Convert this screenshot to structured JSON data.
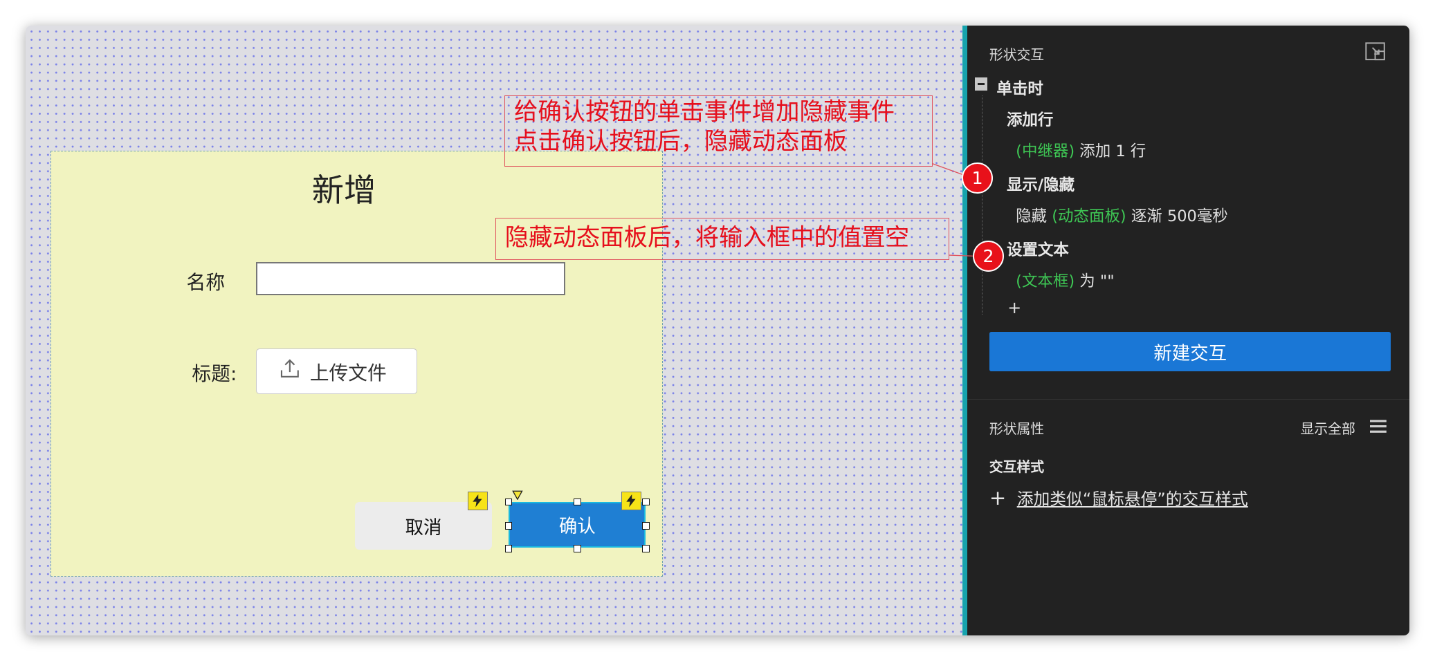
{
  "dialog": {
    "title": "新增",
    "name_label": "名称",
    "name_value": "",
    "title_label": "标题:",
    "upload_label": "上传文件",
    "cancel_label": "取消",
    "confirm_label": "确认"
  },
  "annotations": [
    {
      "number": "1",
      "lines": [
        "给确认按钮的单击事件增加隐藏事件",
        "点击确认按钮后，隐藏动态面板"
      ]
    },
    {
      "number": "2",
      "lines": [
        "隐藏动态面板后，将输入框中的值置空"
      ]
    }
  ],
  "panel": {
    "interactions_title": "形状交互",
    "event": "单击时",
    "actions": [
      {
        "name": "添加行",
        "target": "(中继器)",
        "detail": "添加 1 行"
      },
      {
        "name": "显示/隐藏",
        "prefix": "隐藏",
        "target": "(动态面板)",
        "detail": "逐渐 500毫秒"
      },
      {
        "name": "设置文本",
        "target": "(文本框)",
        "detail": "为 \"\""
      }
    ],
    "add_action_symbol": "+",
    "new_interaction_button": "新建交互",
    "properties_title": "形状属性",
    "show_all": "显示全部",
    "interaction_style_title": "交互样式",
    "add_style_link": "添加类似“鼠标悬停”的交互样式"
  },
  "colors": {
    "canvas": "#dedee3",
    "panel": "#222222",
    "accent": "#1a77d6",
    "annotation": "#e60f1c",
    "case_target": "#3ec654"
  },
  "icons": [
    "upload-icon",
    "lightning-icon",
    "collapse-minus-icon",
    "dock-panel-icon",
    "menu-icon",
    "plus-icon"
  ]
}
